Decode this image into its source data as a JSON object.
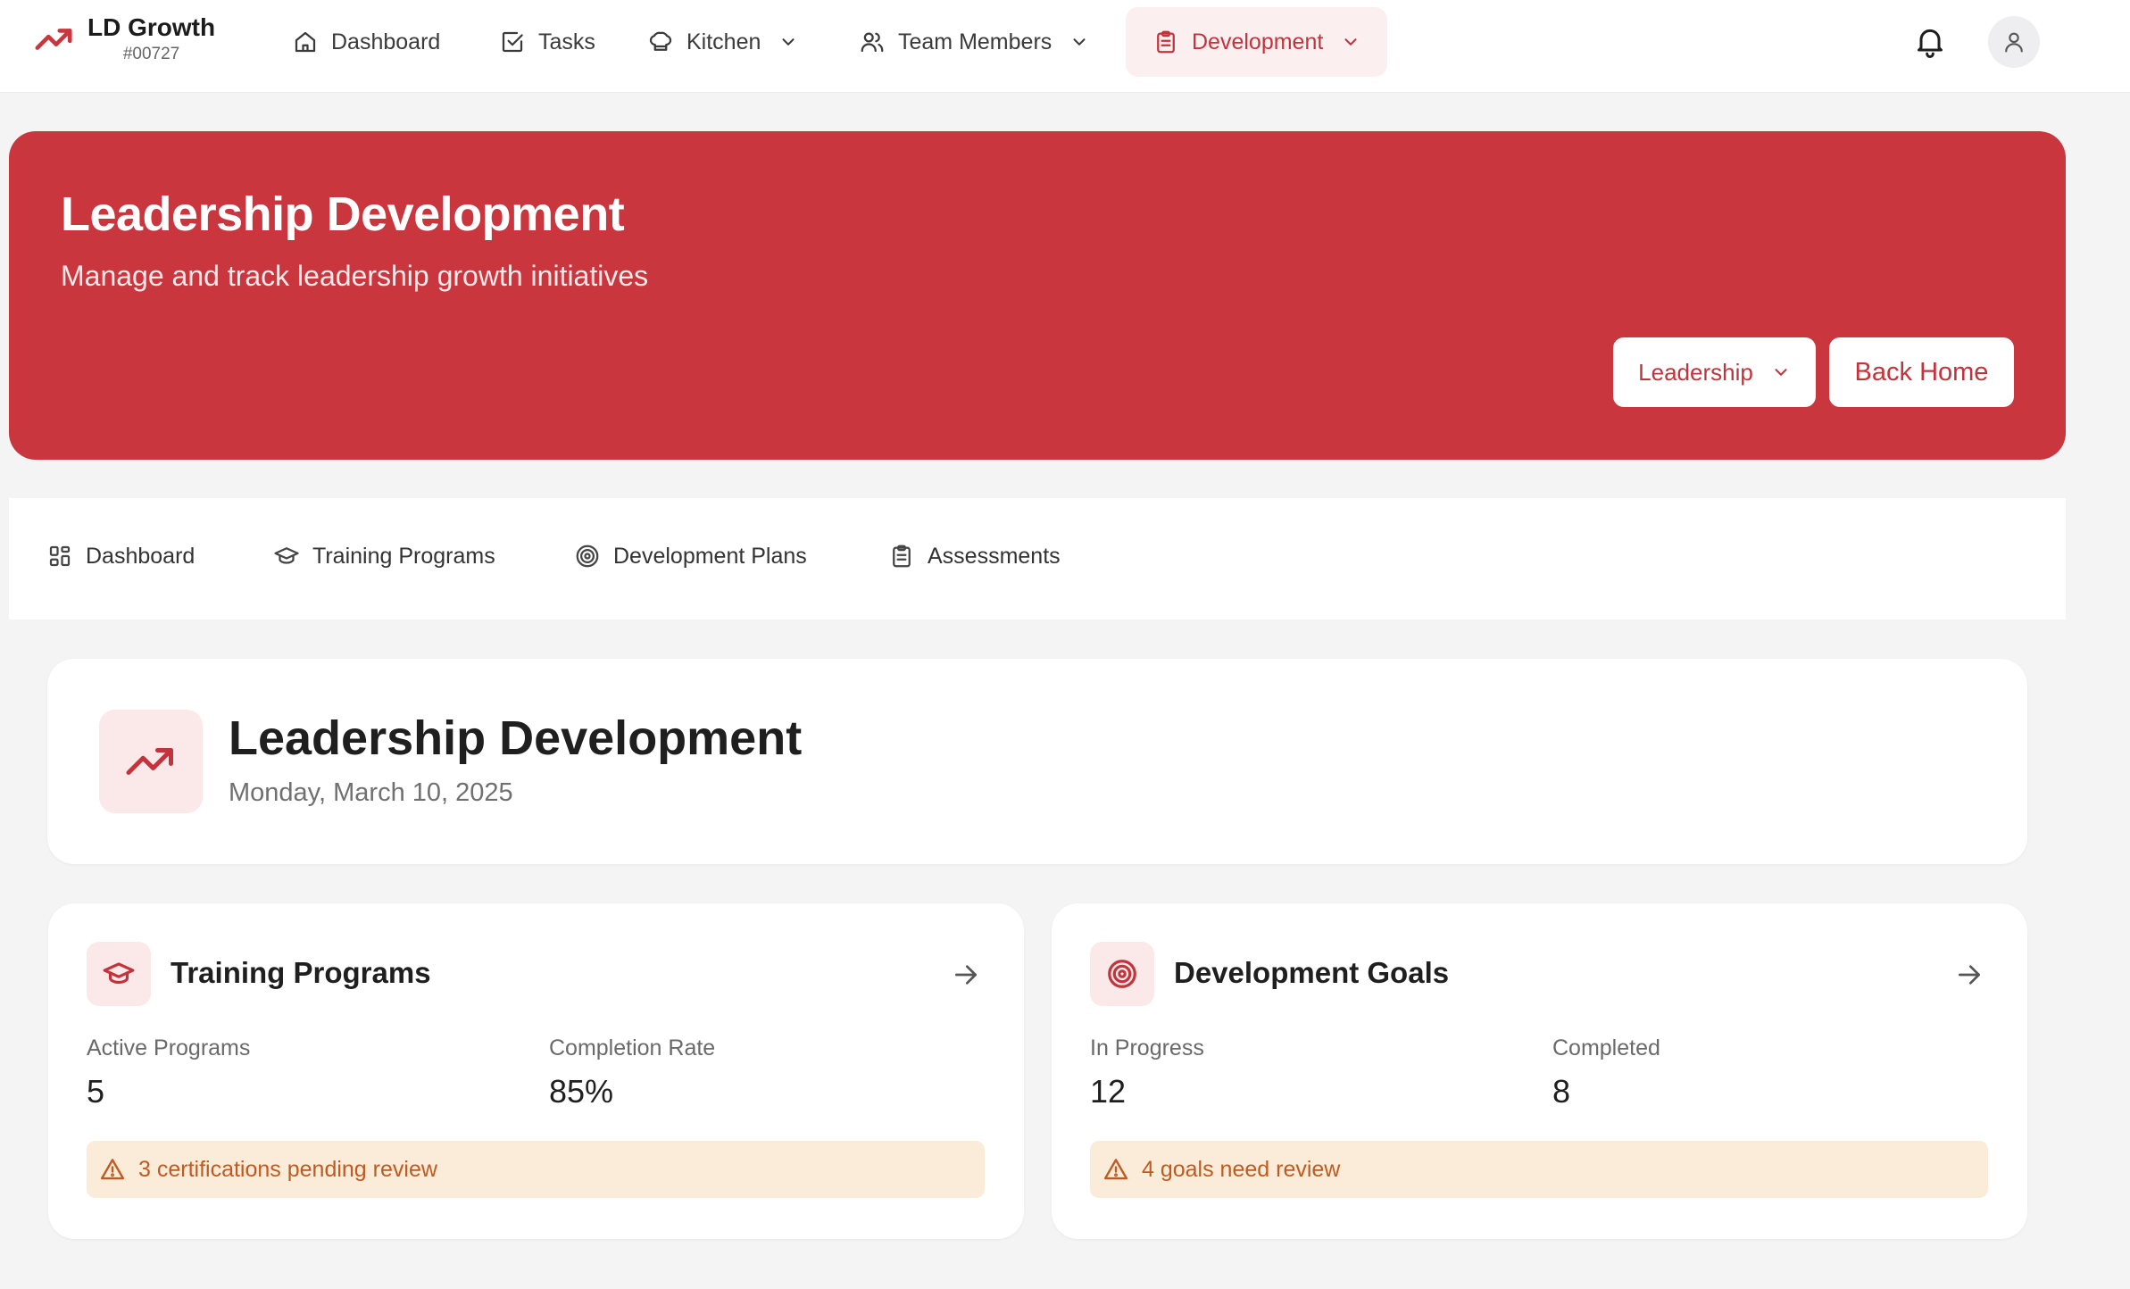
{
  "brand": {
    "name": "LD Growth",
    "id": "#00727"
  },
  "nav": {
    "dashboard": "Dashboard",
    "tasks": "Tasks",
    "kitchen": "Kitchen",
    "team_members": "Team Members",
    "development": "Development"
  },
  "hero": {
    "title": "Leadership Development",
    "subtitle": "Manage and track leadership growth initiatives",
    "select_value": "Leadership",
    "back_label": "Back Home"
  },
  "tabs": {
    "dashboard": "Dashboard",
    "training": "Training Programs",
    "plans": "Development Plans",
    "assessments": "Assessments"
  },
  "heading": {
    "title": "Leadership Development",
    "date": "Monday, March 10, 2025"
  },
  "cards": {
    "training": {
      "title": "Training Programs",
      "stat1_label": "Active Programs",
      "stat1_value": "5",
      "stat2_label": "Completion Rate",
      "stat2_value": "85%",
      "alert": "3 certifications pending review"
    },
    "goals": {
      "title": "Development Goals",
      "stat1_label": "In Progress",
      "stat1_value": "12",
      "stat2_label": "Completed",
      "stat2_value": "8",
      "alert": "4 goals need review"
    }
  },
  "colors": {
    "accent": "#c9363e",
    "accent_text": "#c2333b",
    "warning_bg": "#fbecd9",
    "warning_text": "#c05a21",
    "page_bg": "#f4f4f4"
  },
  "icons": [
    "trending-up-icon",
    "home-icon",
    "check-square-icon",
    "chef-hat-icon",
    "users-icon",
    "clipboard-icon",
    "chevron-down-icon",
    "bell-icon",
    "user-icon",
    "grid-icon",
    "graduation-cap-icon",
    "target-icon",
    "arrow-right-icon",
    "alert-triangle-icon"
  ]
}
